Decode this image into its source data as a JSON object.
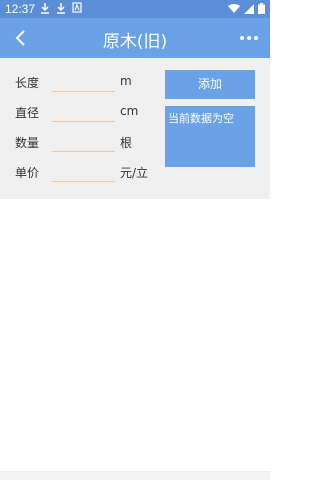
{
  "status_bar": {
    "time": "12:37",
    "icons": [
      "download-icon",
      "download-icon",
      "app-icon",
      "wifi-icon",
      "signal-icon",
      "battery-icon"
    ]
  },
  "app_bar": {
    "title": "原木(旧)",
    "back_icon": "chevron-left-icon",
    "menu_icon": "more-horizontal-icon"
  },
  "form": {
    "fields": [
      {
        "label": "长度",
        "value": "",
        "unit": "m"
      },
      {
        "label": "直径",
        "value": "",
        "unit": "cm"
      },
      {
        "label": "数量",
        "value": "",
        "unit": "根"
      },
      {
        "label": "单价",
        "value": "",
        "unit": "元/立"
      }
    ],
    "add_label": "添加",
    "empty_text": "当前数据为空"
  },
  "colors": {
    "status_bar": "#5a8fd8",
    "app_bar": "#6aa2e8",
    "button": "#6aa2e8",
    "form_bg": "#f0f0f0",
    "input_underline": "#f2c6a0"
  }
}
